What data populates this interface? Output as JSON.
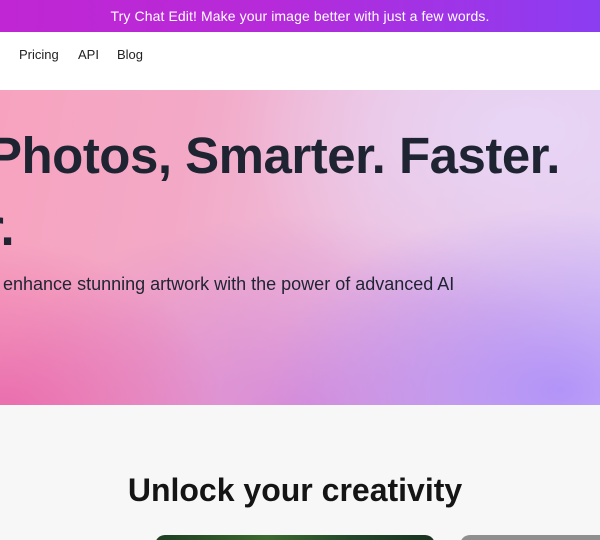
{
  "promo_banner": {
    "text": "Try Chat Edit!  Make your image better with just a few words."
  },
  "nav": {
    "items": [
      {
        "label": "Pricing"
      },
      {
        "label": "API"
      },
      {
        "label": "Blog"
      }
    ]
  },
  "hero": {
    "title_line1": "Photos, Smarter. Faster.",
    "title_line2": "r.",
    "subtitle": "enhance stunning artwork with the power of advanced AI"
  },
  "section": {
    "title": "Unlock your creativity"
  },
  "colors": {
    "banner_start": "#c026d3",
    "banner_end": "#8b3df2",
    "heading_text": "#1f2433"
  }
}
